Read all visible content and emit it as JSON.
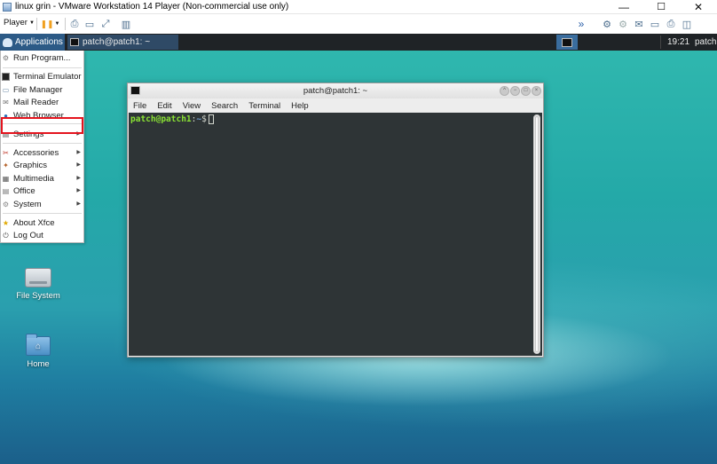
{
  "vm_window": {
    "title": "linux grin - VMware Workstation 14 Player (Non-commercial use only)",
    "controls": {
      "minimize": "—",
      "maximize": "☐",
      "close": "✕"
    }
  },
  "vm_toolbar": {
    "player_label": "Player",
    "player_arrow": "▼",
    "pause_glyph": "❚❚",
    "pause_arrow": "▼",
    "left_icons": [
      "⎙",
      "▭",
      "⤢",
      "▥"
    ],
    "right_icons": [
      "»",
      "⚙",
      "⚙",
      "✉",
      "▭",
      "⎙",
      "◫"
    ]
  },
  "panel": {
    "applications_label": "Applications",
    "task_label": "patch@patch1: ~",
    "clock": "19:21",
    "user": "patch"
  },
  "app_menu": {
    "items": [
      {
        "label": "Run Program...",
        "icon": "⚙",
        "arrow": ""
      },
      {
        "label": "Terminal Emulator",
        "icon": "▪",
        "arrow": ""
      },
      {
        "label": "File Manager",
        "icon": "▭",
        "arrow": ""
      },
      {
        "label": "Mail Reader",
        "icon": "✉",
        "arrow": ""
      },
      {
        "label": "Web Browser",
        "icon": "●",
        "arrow": ""
      },
      {
        "label": "Settings",
        "icon": "▤",
        "arrow": "▶"
      },
      {
        "label": "Accessories",
        "icon": "✂",
        "arrow": "▶"
      },
      {
        "label": "Graphics",
        "icon": "✦",
        "arrow": "▶"
      },
      {
        "label": "Multimedia",
        "icon": "▦",
        "arrow": "▶"
      },
      {
        "label": "Office",
        "icon": "▤",
        "arrow": "▶"
      },
      {
        "label": "System",
        "icon": "⚙",
        "arrow": "▶"
      },
      {
        "label": "About Xfce",
        "icon": "★",
        "arrow": ""
      },
      {
        "label": "Log Out",
        "icon": "⏻",
        "arrow": ""
      }
    ],
    "highlighted_item": "Terminal Emulator",
    "highlight_color": "#e4141e"
  },
  "desktop": {
    "icons": [
      {
        "label": "File System",
        "icon": "drive-icon"
      },
      {
        "label": "Home",
        "icon": "home-folder-icon",
        "glyph": "⌂"
      }
    ]
  },
  "terminal": {
    "title": "patch@patch1: ~",
    "menu": [
      "File",
      "Edit",
      "View",
      "Search",
      "Terminal",
      "Help"
    ],
    "window_buttons": [
      "^",
      "−",
      "□",
      "×"
    ],
    "prompt_user": "patch@patch1",
    "prompt_sep": ":",
    "prompt_path": "~",
    "prompt_symbol": "$",
    "colors": {
      "background": "#2e3436",
      "user": "#8ae234",
      "path": "#729fcf",
      "text": "#d3d7cf"
    }
  }
}
